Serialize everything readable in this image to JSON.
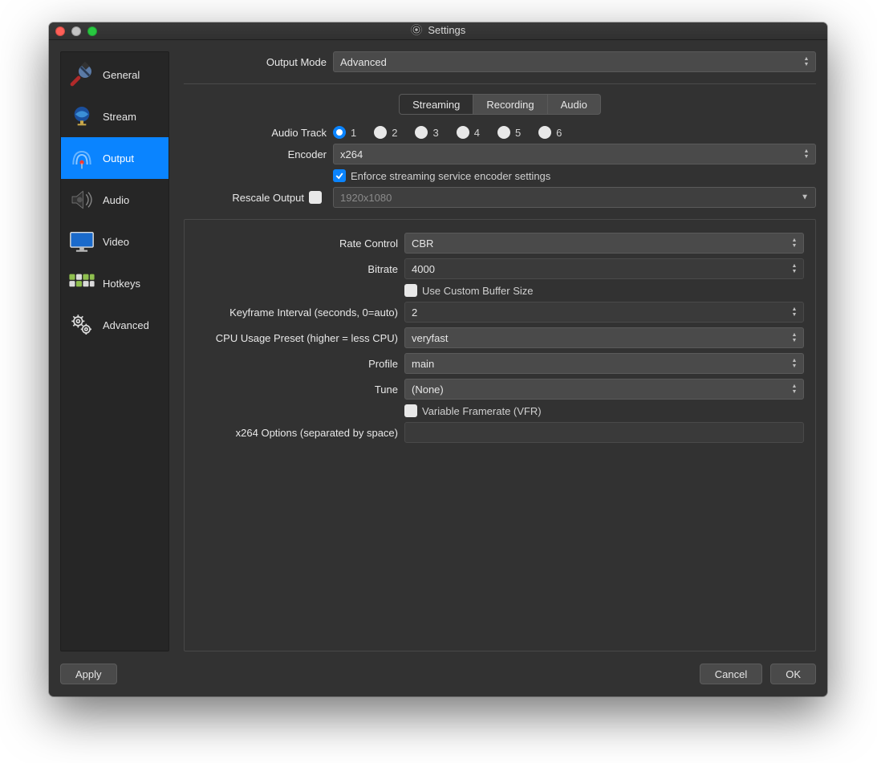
{
  "window": {
    "title": "Settings"
  },
  "sidebar": {
    "items": [
      {
        "label": "General"
      },
      {
        "label": "Stream"
      },
      {
        "label": "Output"
      },
      {
        "label": "Audio"
      },
      {
        "label": "Video"
      },
      {
        "label": "Hotkeys"
      },
      {
        "label": "Advanced"
      }
    ],
    "selected": "Output"
  },
  "outputMode": {
    "label": "Output Mode",
    "value": "Advanced"
  },
  "tabs": {
    "items": [
      "Streaming",
      "Recording",
      "Audio"
    ],
    "active": "Streaming"
  },
  "streaming": {
    "audioTrack": {
      "label": "Audio Track",
      "options": [
        "1",
        "2",
        "3",
        "4",
        "5",
        "6"
      ],
      "selected": "1"
    },
    "encoder": {
      "label": "Encoder",
      "value": "x264"
    },
    "enforce": {
      "label": "Enforce streaming service encoder settings",
      "checked": true
    },
    "rescale": {
      "label": "Rescale Output",
      "checked": false,
      "placeholder": "1920x1080"
    },
    "rateControl": {
      "label": "Rate Control",
      "value": "CBR"
    },
    "bitrate": {
      "label": "Bitrate",
      "value": "4000"
    },
    "customBuffer": {
      "label": "Use Custom Buffer Size",
      "checked": false
    },
    "keyframe": {
      "label": "Keyframe Interval (seconds, 0=auto)",
      "value": "2"
    },
    "cpuPreset": {
      "label": "CPU Usage Preset (higher = less CPU)",
      "value": "veryfast"
    },
    "profile": {
      "label": "Profile",
      "value": "main"
    },
    "tune": {
      "label": "Tune",
      "value": "(None)"
    },
    "vfr": {
      "label": "Variable Framerate (VFR)",
      "checked": false
    },
    "x264opts": {
      "label": "x264 Options (separated by space)",
      "value": ""
    }
  },
  "buttons": {
    "apply": "Apply",
    "cancel": "Cancel",
    "ok": "OK"
  },
  "colors": {
    "accent": "#0a84ff"
  }
}
